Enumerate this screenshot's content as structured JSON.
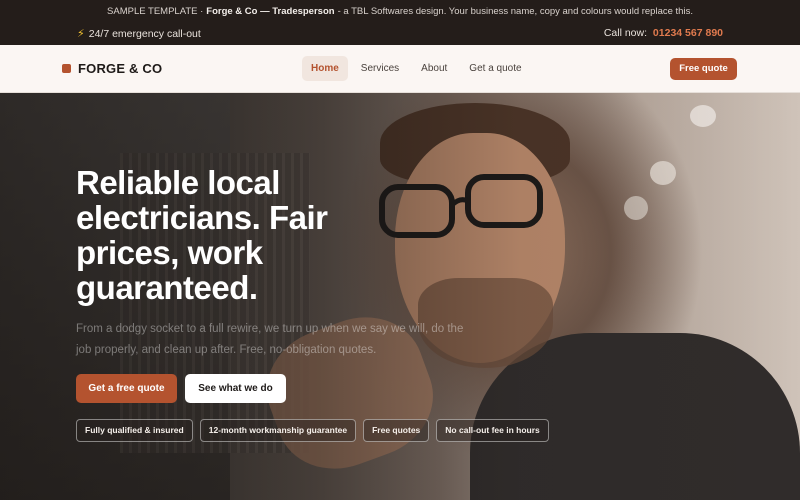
{
  "banner": {
    "prefix": "SAMPLE TEMPLATE ·",
    "brand": "Forge & Co — Tradesperson",
    "suffix": "- a TBL Softwares design. Your business name, copy and colours would replace this."
  },
  "utility": {
    "emergency_icon": "lightning-bolt-icon",
    "emergency": "24/7 emergency call-out",
    "call_label": "Call now:",
    "phone": "01234 567 890"
  },
  "nav": {
    "brand": "FORGE & CO",
    "links": [
      "Home",
      "Services",
      "About",
      "Get a quote"
    ],
    "active_index": 0,
    "cta": "Free quote"
  },
  "hero": {
    "headline": "Reliable local electricians. Fair prices, work guaranteed.",
    "sub": "From a dodgy socket to a full rewire, we turn up when we say we will, do the job properly, and clean up after. Free, no-obligation quotes.",
    "primary_cta": "Get a free quote",
    "secondary_cta": "See what we do",
    "badges": [
      "Fully qualified & insured",
      "12-month workmanship guarantee",
      "Free quotes",
      "No call-out fee in hours"
    ]
  },
  "colors": {
    "accent": "#b4532f",
    "phone": "#e07a4e",
    "dark": "#241d1a"
  }
}
